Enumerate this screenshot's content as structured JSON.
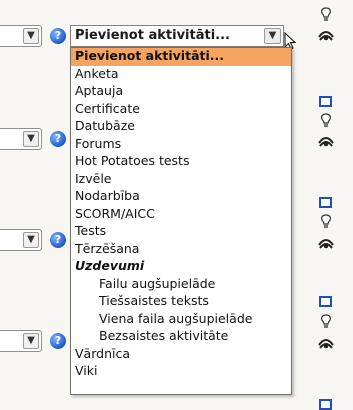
{
  "activity_select": {
    "value": "Pievienot aktivitāti...",
    "options": [
      {
        "label": "Pievienot aktivitāti...",
        "kind": "selected"
      },
      {
        "label": "Anketa",
        "kind": "item"
      },
      {
        "label": "Aptauja",
        "kind": "item"
      },
      {
        "label": "Certificate",
        "kind": "item"
      },
      {
        "label": "Datubāze",
        "kind": "item"
      },
      {
        "label": "Forums",
        "kind": "item"
      },
      {
        "label": "Hot Potatoes tests",
        "kind": "item"
      },
      {
        "label": "Izvēle",
        "kind": "item"
      },
      {
        "label": "Nodarbība",
        "kind": "item"
      },
      {
        "label": "SCORM/AICC",
        "kind": "item"
      },
      {
        "label": "Tests",
        "kind": "item"
      },
      {
        "label": "Tērzēšana",
        "kind": "item"
      },
      {
        "label": "Uzdevumi",
        "kind": "group"
      },
      {
        "label": "Failu augšupielāde",
        "kind": "sub"
      },
      {
        "label": "Tiešsaistes teksts",
        "kind": "sub"
      },
      {
        "label": "Viena faila augšupielāde",
        "kind": "sub"
      },
      {
        "label": "Bezsaistes aktivitāte",
        "kind": "sub"
      },
      {
        "label": "Vārdnīca",
        "kind": "item"
      },
      {
        "label": "Viki",
        "kind": "item"
      }
    ]
  },
  "colors": {
    "highlight": "#f6a560",
    "help_icon": "#1e5ac8",
    "box_icon": "#1f4fbf"
  },
  "icons": {
    "help": "help-icon",
    "hint": "lightbulb-icon",
    "visibility": "eye-icon",
    "block": "square-icon",
    "dropdown": "chevron-down-icon"
  }
}
